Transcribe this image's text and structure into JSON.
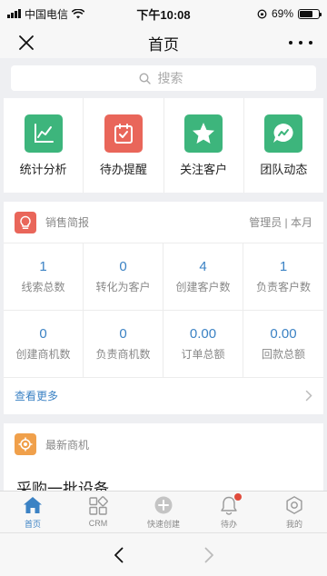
{
  "status_bar": {
    "carrier": "中国电信",
    "time": "下午10:08",
    "battery": "69%",
    "battery_level": 0.69
  },
  "nav": {
    "title": "首页",
    "close_icon": "close-icon",
    "more_icon": "more-icon"
  },
  "search": {
    "placeholder": "搜索"
  },
  "quick_apps": [
    {
      "label": "统计分析",
      "icon": "chart-icon",
      "color": "#3db57c"
    },
    {
      "label": "待办提醒",
      "icon": "todo-icon",
      "color": "#e9665a"
    },
    {
      "label": "关注客户",
      "icon": "star-icon",
      "color": "#3db57c"
    },
    {
      "label": "团队动态",
      "icon": "chat-icon",
      "color": "#3db57c"
    }
  ],
  "sales_brief": {
    "title": "销售简报",
    "meta": "管理员 | 本月",
    "icon": "bulb-icon",
    "icon_color": "#e9665a",
    "stats": [
      {
        "value": "1",
        "label": "线索总数"
      },
      {
        "value": "0",
        "label": "转化为客户"
      },
      {
        "value": "4",
        "label": "创建客户数"
      },
      {
        "value": "1",
        "label": "负责客户数"
      },
      {
        "value": "0",
        "label": "创建商机数"
      },
      {
        "value": "0",
        "label": "负责商机数"
      },
      {
        "value": "0.00",
        "label": "订单总额"
      },
      {
        "value": "0.00",
        "label": "回款总额"
      }
    ],
    "more_label": "查看更多"
  },
  "opportunities": {
    "title": "最新商机",
    "icon": "target-icon",
    "icon_color": "#f0a04b",
    "first_item": "采购一批设备"
  },
  "tabbar": [
    {
      "label": "首页",
      "icon": "home-icon",
      "active": true
    },
    {
      "label": "CRM",
      "icon": "apps-grid-icon",
      "active": false
    },
    {
      "label": "快速创建",
      "icon": "plus-circle-icon",
      "active": false
    },
    {
      "label": "待办",
      "icon": "bell-icon",
      "active": false,
      "badge": true
    },
    {
      "label": "我的",
      "icon": "settings-icon",
      "active": false
    }
  ],
  "colors": {
    "accent": "#3b82c4",
    "green": "#3db57c",
    "red": "#e9665a",
    "orange": "#f0a04b"
  }
}
